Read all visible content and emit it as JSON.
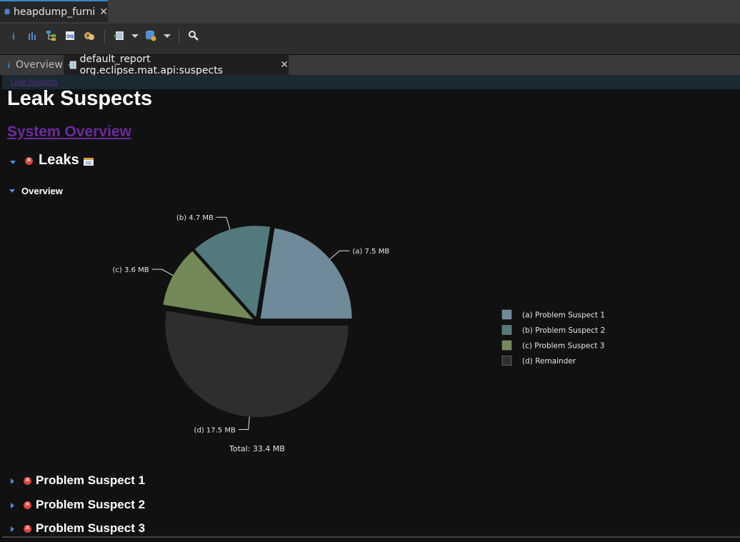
{
  "editor_tab": {
    "title": "heapdump_furni",
    "icon": "heap-dump-icon"
  },
  "toolbar": {
    "buttons": [
      "overview-icon",
      "histogram-icon",
      "dominator-tree-icon",
      "oql-icon",
      "thread-overview-icon",
      "run-expert-report-icon",
      "query-browser-icon",
      "find-object-icon"
    ]
  },
  "view_tabs": [
    {
      "label": "Overview",
      "icon": "info-icon",
      "active": false
    },
    {
      "label": "default_report org.eclipse.mat.api:suspects",
      "icon": "report-icon",
      "active": true
    }
  ],
  "report": {
    "breadcrumb": "Leak Suspects",
    "title": "Leak Suspects",
    "system_overview_link": "System Overview",
    "leaks_heading": "Leaks",
    "overview_heading": "Overview",
    "suspects": [
      "Problem Suspect 1",
      "Problem Suspect 2",
      "Problem Suspect 3"
    ]
  },
  "chart_data": {
    "type": "pie",
    "slices": [
      {
        "id": "(a)",
        "value": 7.5,
        "label": "7.5 MB",
        "name": "Problem Suspect 1",
        "color": "#6f8a99"
      },
      {
        "id": "(b)",
        "value": 4.7,
        "label": "4.7 MB",
        "name": "Problem Suspect 2",
        "color": "#527a7c"
      },
      {
        "id": "(c)",
        "value": 3.6,
        "label": "3.6 MB",
        "name": "Problem Suspect 3",
        "color": "#738958"
      },
      {
        "id": "(d)",
        "value": 17.5,
        "label": "17.5 MB",
        "name": "Remainder",
        "color": "#2e2e2e"
      }
    ],
    "total_label": "Total: 33.4 MB",
    "legend_position": "right"
  },
  "colors": {
    "link_purple": "#6a2c9e",
    "accent_blue": "#4d8fd6",
    "error_red": "#d8443a"
  }
}
